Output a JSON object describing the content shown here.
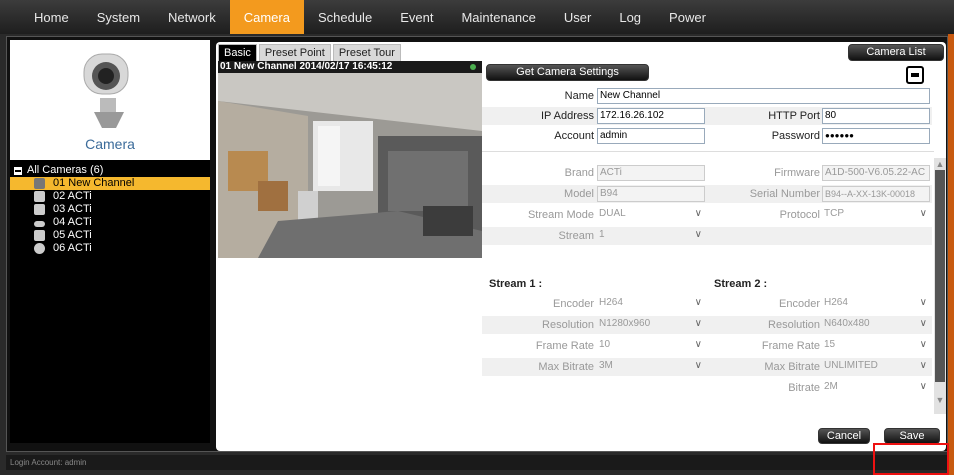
{
  "nav": {
    "items": [
      "Home",
      "System",
      "Network",
      "Camera",
      "Schedule",
      "Event",
      "Maintenance",
      "User",
      "Log",
      "Power"
    ],
    "active": "Camera"
  },
  "left": {
    "title": "Camera",
    "tree_root": "All Cameras (6)",
    "cameras": [
      {
        "label": "01  New Channel",
        "icon": "box-camera-icon"
      },
      {
        "label": "02  ACTi",
        "icon": "box-camera-icon"
      },
      {
        "label": "03  ACTi",
        "icon": "box-camera-icon"
      },
      {
        "label": "04  ACTi",
        "icon": "bullet-camera-icon"
      },
      {
        "label": "05  ACTi",
        "icon": "box-camera-icon"
      },
      {
        "label": "06  ACTi",
        "icon": "dome-camera-icon"
      }
    ]
  },
  "tabs": [
    "Basic",
    "Preset Point",
    "Preset Tour"
  ],
  "preview": {
    "caption": "01 New Channel  2014/02/17 16:45:12"
  },
  "buttons": {
    "camera_list": "Camera List",
    "get_settings": "Get Camera Settings",
    "cancel": "Cancel",
    "save": "Save"
  },
  "basic": {
    "name_label": "Name",
    "name_value": "New Channel",
    "ip_label": "IP Address",
    "ip_value": "172.16.26.102",
    "http_label": "HTTP Port",
    "http_value": "80",
    "account_label": "Account",
    "account_value": "admin",
    "password_label": "Password",
    "password_value": "●●●●●●"
  },
  "info": {
    "brand_label": "Brand",
    "brand_value": "ACTi",
    "firmware_label": "Firmware",
    "firmware_value": "A1D-500-V6.05.22-AC",
    "model_label": "Model",
    "model_value": "B94",
    "serial_label": "Serial Number",
    "serial_value": "B94--A-XX-13K-00018",
    "stream_mode_label": "Stream Mode",
    "stream_mode_value": "DUAL",
    "protocol_label": "Protocol",
    "protocol_value": "TCP",
    "stream_label": "Stream",
    "stream_value": "1"
  },
  "stream1": {
    "heading": "Stream 1 :",
    "encoder_label": "Encoder",
    "encoder_value": "H264",
    "resolution_label": "Resolution",
    "resolution_value": "N1280x960",
    "framerate_label": "Frame Rate",
    "framerate_value": "10",
    "maxbitrate_label": "Max Bitrate",
    "maxbitrate_value": "3M"
  },
  "stream2": {
    "heading": "Stream 2 :",
    "encoder_label": "Encoder",
    "encoder_value": "H264",
    "resolution_label": "Resolution",
    "resolution_value": "N640x480",
    "framerate_label": "Frame Rate",
    "framerate_value": "15",
    "maxbitrate_label": "Max Bitrate",
    "maxbitrate_value": "UNLIMITED",
    "bitrate_label": "Bitrate",
    "bitrate_value": "2M"
  },
  "status": {
    "login": "Login Account: admin"
  },
  "colors": {
    "accent": "#f39a1e",
    "selected_row": "#f5b82e",
    "title_blue": "#3b6b9a"
  }
}
